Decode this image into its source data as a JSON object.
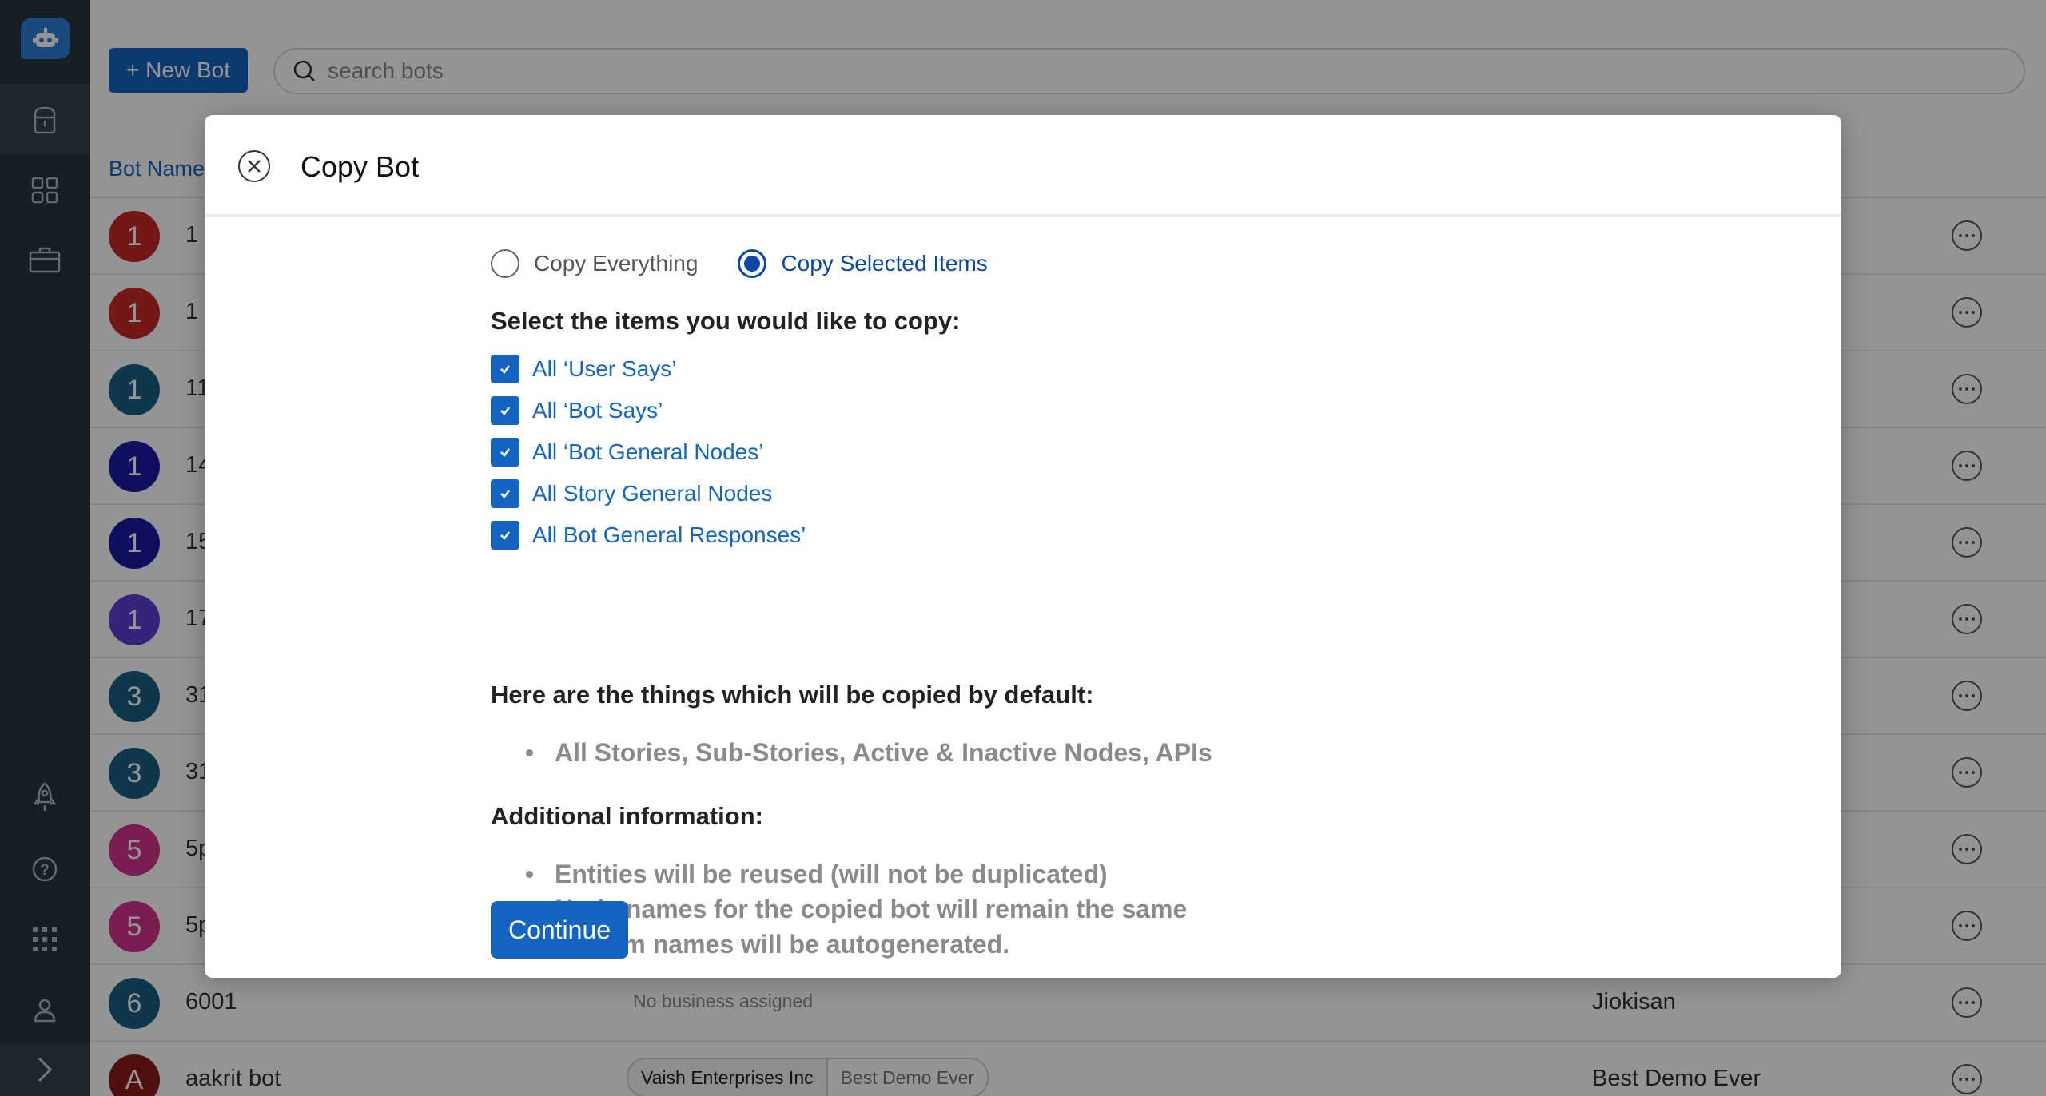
{
  "toolbar": {
    "new_bot_label": "+ New Bot",
    "search_placeholder": "search bots"
  },
  "table": {
    "column_bot_name": "Bot Name",
    "rows": [
      {
        "initial": "1",
        "name": "1",
        "color": "#c62828"
      },
      {
        "initial": "1",
        "name": "1",
        "color": "#c62828"
      },
      {
        "initial": "1",
        "name": "11",
        "color": "#1a5f82"
      },
      {
        "initial": "1",
        "name": "14",
        "color": "#1a1aa6"
      },
      {
        "initial": "1",
        "name": "15",
        "color": "#1a1aa6"
      },
      {
        "initial": "1",
        "name": "17",
        "color": "#5d3fd3"
      },
      {
        "initial": "3",
        "name": "31",
        "color": "#1a5f82"
      },
      {
        "initial": "3",
        "name": "31",
        "color": "#1a5f82"
      },
      {
        "initial": "5",
        "name": "5p",
        "color": "#d6338c"
      },
      {
        "initial": "5",
        "name": "5p",
        "color": "#d6338c"
      },
      {
        "initial": "6",
        "name": "6001",
        "color": "#1a5f82",
        "business": "No business assigned",
        "owner": "Jiokisan"
      },
      {
        "initial": "A",
        "name": "aakrit bot",
        "color": "#8b1a1a",
        "tag_primary": "Vaish Enterprises Inc",
        "tag_secondary": "Best Demo Ever",
        "owner": "Best Demo Ever"
      }
    ]
  },
  "modal": {
    "title": "Copy Bot",
    "radio_everything": "Copy Everything",
    "radio_selected": "Copy Selected Items",
    "selected_option": "Copy Selected Items",
    "select_heading": "Select the items you would like to copy:",
    "items": [
      {
        "label": "All ‘User Says’",
        "checked": true
      },
      {
        "label": "All ‘Bot Says’",
        "checked": true
      },
      {
        "label": "All ‘Bot General Nodes’",
        "checked": true
      },
      {
        "label": "All Story General Nodes",
        "checked": true
      },
      {
        "label": "All Bot General Responses’",
        "checked": true
      }
    ],
    "default_heading": "Here are the things which will be copied by default:",
    "default_items": [
      "All Stories, Sub-Stories, Active & Inactive Nodes, APIs"
    ],
    "additional_heading": "Additional information:",
    "additional_items": [
      "Entities will be reused (will not be duplicated)",
      "Node names for the copied bot will remain the same",
      "System names will be autogenerated."
    ],
    "continue_label": "Continue"
  },
  "icons": {
    "logo": "robot-icon",
    "nav": [
      "bot-icon",
      "grid-icon",
      "briefcase-icon",
      "rocket-icon",
      "help-icon",
      "apps-icon",
      "user-icon",
      "chevron-right-icon"
    ],
    "close": "close-icon",
    "search": "search-icon"
  },
  "colors": {
    "primary": "#1565c0",
    "sidebar": "#2a3441",
    "muted_text": "#8a8a8a"
  }
}
